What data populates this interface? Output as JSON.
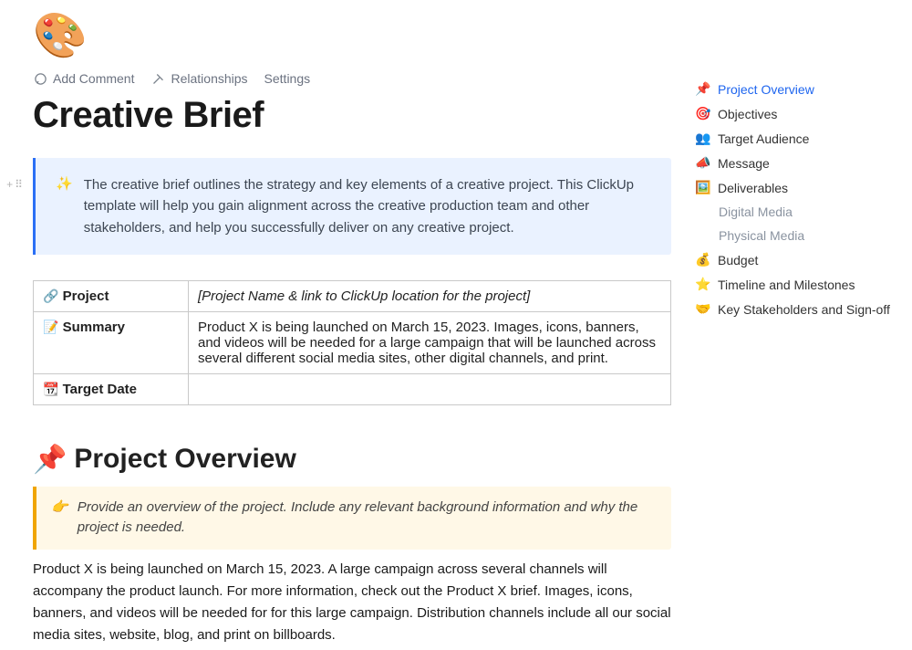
{
  "page": {
    "emoji": "🎨",
    "title": "Creative Brief"
  },
  "toolbar": {
    "add_comment": "Add Comment",
    "relationships": "Relationships",
    "settings": "Settings"
  },
  "intro_callout": {
    "icon": "✨",
    "text": "The creative brief outlines the strategy and key elements of a creative project. This ClickUp template will help you gain alignment across the creative production team and other stakeholders, and help you successfully deliver on any creative project."
  },
  "info_table": {
    "project": {
      "icon": "🔗",
      "label": "Project",
      "value": "[Project Name & link to ClickUp location for the project]"
    },
    "summary": {
      "icon": "📝",
      "label": "Summary",
      "value": "Product X is being launched on March 15, 2023. Images, icons, banners, and videos will be needed for a large campaign that will be launched across several different social media sites, other digital channels, and print."
    },
    "target_date": {
      "icon": "📆",
      "label": "Target Date",
      "value": ""
    }
  },
  "overview": {
    "icon": "📌",
    "heading": "Project Overview",
    "help_icon": "👉",
    "help": "Provide an overview of the project. Include any relevant background information and why the project is needed.",
    "body": "Product X is being launched on March 15, 2023. A large campaign across several channels will accompany the product launch. For more information, check out the Product X brief. Images, icons, banners, and videos will be needed for for this large campaign. Distribution channels include all our social media sites, website, blog, and print on billboards."
  },
  "toc": [
    {
      "icon": "📌",
      "label": "Project Overview",
      "active": true
    },
    {
      "icon": "🎯",
      "label": "Objectives"
    },
    {
      "icon": "👥",
      "label": "Target Audience"
    },
    {
      "icon": "📣",
      "label": "Message"
    },
    {
      "icon": "🖼️",
      "label": "Deliverables"
    },
    {
      "icon": "",
      "label": "Digital Media",
      "sub": true
    },
    {
      "icon": "",
      "label": "Physical Media",
      "sub": true
    },
    {
      "icon": "💰",
      "label": "Budget"
    },
    {
      "icon": "⭐",
      "label": "Timeline and Milestones"
    },
    {
      "icon": "🤝",
      "label": "Key Stakeholders and Sign-off"
    }
  ]
}
